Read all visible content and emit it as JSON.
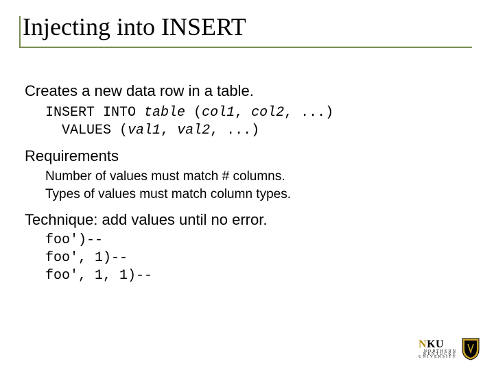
{
  "title": "Injecting into INSERT",
  "lead": "Creates a new data row in a table.",
  "sqlExample": {
    "line1_pre": "INSERT INTO ",
    "line1_table": "table",
    "line1_mid": " (",
    "line1_c1": "col1",
    "line1_sep": ", ",
    "line1_c2": "col2",
    "line1_post": ", ...)",
    "line2_pre": "  VALUES (",
    "line2_v1": "val1",
    "line2_sep": ", ",
    "line2_v2": "val2",
    "line2_post": ", ...)"
  },
  "reqHeading": "Requirements",
  "req1": "Number of values must match # columns.",
  "req2": "Types of values must match column types.",
  "techHeading": "Technique: add values until no error.",
  "tech1": "foo')--",
  "tech2": "foo', 1)--",
  "tech3": "foo', 1, 1)--",
  "logo": {
    "n": "N",
    "ku": "KU",
    "sub1": "NORTHERN",
    "sub2": "KENTUCKY",
    "sub3": "UNIVERSITY"
  }
}
